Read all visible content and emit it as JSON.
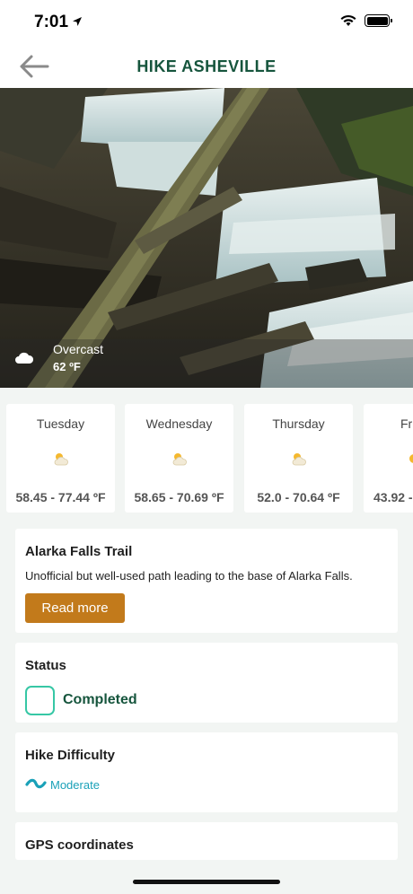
{
  "status_bar": {
    "time": "7:01"
  },
  "header": {
    "title": "HIKE ASHEVILLE"
  },
  "hero": {
    "condition": "Overcast",
    "temperature": "62 ºF"
  },
  "forecast": [
    {
      "day": "Tuesday",
      "range": "58.45 - 77.44 ºF"
    },
    {
      "day": "Wednesday",
      "range": "58.65 - 70.69 ºF"
    },
    {
      "day": "Thursday",
      "range": "52.0 - 70.64 ºF"
    },
    {
      "day": "Fr",
      "range": "43.92 -"
    }
  ],
  "trail": {
    "name": "Alarka Falls Trail",
    "description": "Unofficial but well-used path leading to the base of Alarka Falls.",
    "read_more_label": "Read more"
  },
  "status": {
    "title": "Status",
    "value": "Completed"
  },
  "difficulty": {
    "title": "Hike Difficulty",
    "value": "Moderate"
  },
  "gps": {
    "title": "GPS coordinates"
  },
  "colors": {
    "brand_green": "#16553d",
    "accent_orange": "#c27a1b",
    "checkbox_teal": "#36c7a5",
    "difficulty_blue": "#1aa1b8"
  }
}
